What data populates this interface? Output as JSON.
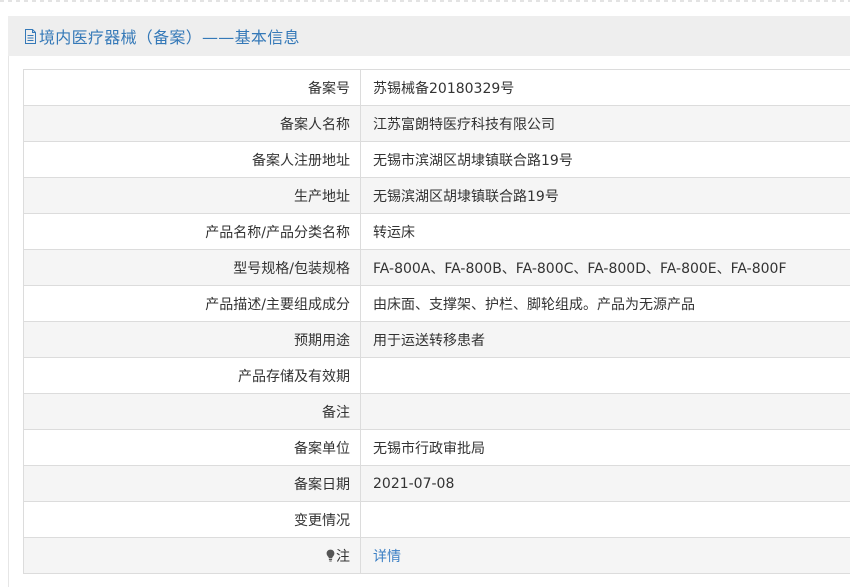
{
  "header": {
    "icon": "document-icon",
    "title": "境内医疗器械（备案）——基本信息"
  },
  "rows": [
    {
      "label": "备案号",
      "value": "苏锡械备20180329号"
    },
    {
      "label": "备案人名称",
      "value": "江苏富朗特医疗科技有限公司"
    },
    {
      "label": "备案人注册地址",
      "value": "无锡市滨湖区胡埭镇联合路19号"
    },
    {
      "label": "生产地址",
      "value": "无锡滨湖区胡埭镇联合路19号"
    },
    {
      "label": "产品名称/产品分类名称",
      "value": "转运床"
    },
    {
      "label": "型号规格/包装规格",
      "value": "FA-800A、FA-800B、FA-800C、FA-800D、FA-800E、FA-800F"
    },
    {
      "label": "产品描述/主要组成成分",
      "value": "由床面、支撑架、护栏、脚轮组成。产品为无源产品"
    },
    {
      "label": "预期用途",
      "value": "用于运送转移患者"
    },
    {
      "label": "产品存储及有效期",
      "value": ""
    },
    {
      "label": "备注",
      "value": ""
    },
    {
      "label": "备案单位",
      "value": "无锡市行政审批局"
    },
    {
      "label": "备案日期",
      "value": "2021-07-08"
    },
    {
      "label": "变更情况",
      "value": ""
    }
  ],
  "note_row": {
    "icon": "lightbulb-icon",
    "label": "注",
    "link": "详情"
  },
  "colors": {
    "title": "#3579b8",
    "link": "#3b7fc4",
    "stripe": "#f5f5f5",
    "header_bg": "#eeeeee"
  }
}
